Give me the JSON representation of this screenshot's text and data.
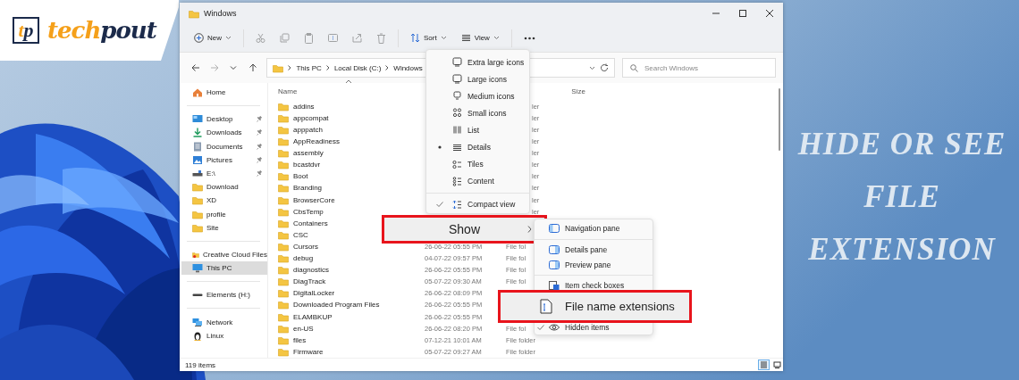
{
  "logo": {
    "mark_parts": [
      "t",
      "p"
    ],
    "name_parts": [
      "tech",
      "pout"
    ]
  },
  "headline_lines": [
    "HIDE OR SEE",
    "FILE",
    "EXTENSION"
  ],
  "window": {
    "title": "Windows"
  },
  "toolbar": [
    {
      "kind": "new",
      "label": "New",
      "disabled": false
    },
    {
      "kind": "cut",
      "disabled": true
    },
    {
      "kind": "copy",
      "disabled": true
    },
    {
      "kind": "paste",
      "disabled": true
    },
    {
      "kind": "rename",
      "disabled": true
    },
    {
      "kind": "share",
      "disabled": true
    },
    {
      "kind": "delete",
      "disabled": true
    },
    {
      "kind": "sort",
      "label": "Sort",
      "disabled": false
    },
    {
      "kind": "view",
      "label": "View",
      "disabled": false
    },
    {
      "kind": "more",
      "disabled": false
    }
  ],
  "address": {
    "path": [
      "This PC",
      "Local Disk (C:)",
      "Windows"
    ],
    "search_placeholder": "Search Windows"
  },
  "sidebar": {
    "items": [
      {
        "kind": "home",
        "label": "Home",
        "pinned": false,
        "selected": false
      },
      {
        "kind": "separator"
      },
      {
        "kind": "desktop",
        "label": "Desktop",
        "pinned": true,
        "selected": false
      },
      {
        "kind": "download",
        "label": "Downloads",
        "pinned": true,
        "selected": false
      },
      {
        "kind": "document",
        "label": "Documents",
        "pinned": true,
        "selected": false
      },
      {
        "kind": "picture",
        "label": "Pictures",
        "pinned": true,
        "selected": false
      },
      {
        "kind": "usb",
        "label": "E:\\",
        "pinned": true,
        "selected": false
      },
      {
        "kind": "folder",
        "label": "Download",
        "pinned": false,
        "selected": false
      },
      {
        "kind": "folder",
        "label": "XD",
        "pinned": false,
        "selected": false
      },
      {
        "kind": "folder",
        "label": "profile",
        "pinned": false,
        "selected": false
      },
      {
        "kind": "folder",
        "label": "Site",
        "pinned": false,
        "selected": false
      },
      {
        "kind": "separator"
      },
      {
        "kind": "cloud",
        "label": "Creative Cloud Files",
        "pinned": false,
        "selected": false
      },
      {
        "kind": "pc",
        "label": "This PC",
        "pinned": false,
        "selected": true
      },
      {
        "kind": "separator"
      },
      {
        "kind": "drive",
        "label": "Elements (H:)",
        "pinned": false,
        "selected": false
      },
      {
        "kind": "separator"
      },
      {
        "kind": "network",
        "label": "Network",
        "pinned": false,
        "selected": false
      },
      {
        "kind": "linux",
        "label": "Linux",
        "pinned": false,
        "selected": false
      }
    ]
  },
  "table": {
    "columns": [
      "Name",
      "Size"
    ],
    "rows": [
      {
        "name": "addins",
        "type": "ler"
      },
      {
        "name": "appcompat",
        "type": "ler"
      },
      {
        "name": "apppatch",
        "type": "ler"
      },
      {
        "name": "AppReadiness",
        "type": "ler"
      },
      {
        "name": "assembly",
        "type": "ler"
      },
      {
        "name": "bcastdvr",
        "type": "ler"
      },
      {
        "name": "Boot",
        "type": "ler"
      },
      {
        "name": "Branding",
        "type": "ler"
      },
      {
        "name": "BrowserCore",
        "type": "ler"
      },
      {
        "name": "CbsTemp",
        "type": "ler"
      },
      {
        "name": "Containers"
      },
      {
        "name": "CSC"
      },
      {
        "name": "Cursors",
        "date": "26-06-22 05:55 PM",
        "type": "File fol"
      },
      {
        "name": "debug",
        "date": "04-07-22 09:57 PM",
        "type": "File fol"
      },
      {
        "name": "diagnostics",
        "date": "26-06-22 05:55 PM",
        "type": "File fol"
      },
      {
        "name": "DiagTrack",
        "date": "05-07-22 09:30 AM",
        "type": "File fol"
      },
      {
        "name": "DigitalLocker",
        "date": "26-06-22 08:09 PM"
      },
      {
        "name": "Downloaded Program Files",
        "date": "26-06-22 05:55 PM"
      },
      {
        "name": "ELAMBKUP",
        "date": "26-06-22 05:55 PM"
      },
      {
        "name": "en-US",
        "date": "26-06-22 08:20 PM",
        "type": "File fol"
      },
      {
        "name": "files",
        "date": "07-12-21 10:01 AM",
        "type": "File folder"
      },
      {
        "name": "Firmware",
        "date": "05-07-22 09:27 AM",
        "type": "File folder"
      }
    ]
  },
  "status_bar": {
    "text": "119 items",
    "views": [
      {
        "kind": "details",
        "selected": true
      },
      {
        "kind": "tiles",
        "selected": false
      }
    ]
  },
  "view_menu": {
    "items": [
      {
        "kind": "xl",
        "label": "Extra large icons",
        "selected": false
      },
      {
        "kind": "large",
        "label": "Large icons",
        "selected": false
      },
      {
        "kind": "medium",
        "label": "Medium icons",
        "selected": false
      },
      {
        "kind": "small",
        "label": "Small icons",
        "selected": false
      },
      {
        "kind": "list",
        "label": "List",
        "selected": false
      },
      {
        "kind": "details",
        "label": "Details",
        "selected": true
      },
      {
        "kind": "tiles",
        "label": "Tiles",
        "selected": false
      },
      {
        "kind": "content",
        "label": "Content",
        "selected": false
      },
      {
        "kind": "compact",
        "label": "Compact view",
        "checked": true
      }
    ],
    "show": {
      "label": "Show"
    }
  },
  "show_menu": {
    "items": [
      {
        "kind": "navpane",
        "label": "Navigation pane",
        "checked": false
      },
      {
        "kind": "detailspane",
        "label": "Details pane",
        "checked": false
      },
      {
        "kind": "previewpane",
        "label": "Preview pane",
        "checked": false
      },
      {
        "kind": "checkboxes",
        "label": "Item check boxes",
        "checked": false
      },
      {
        "kind": "extensions",
        "label": "File name extensions"
      },
      {
        "kind": "hidden",
        "label": "Hidden items",
        "checked": true
      }
    ]
  }
}
